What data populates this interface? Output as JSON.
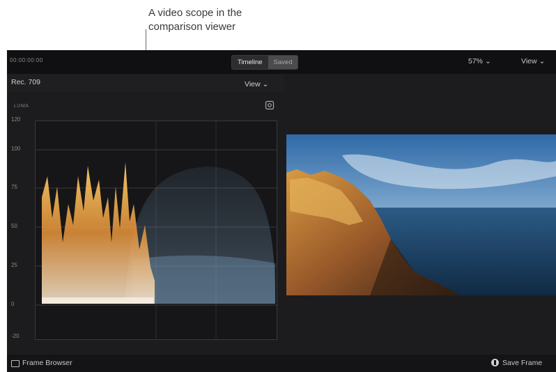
{
  "callout": {
    "line1": "A video scope in the",
    "line2": "comparison viewer"
  },
  "topbar": {
    "timecode": "00:00:00:00",
    "tabs": [
      "Timeline",
      "Saved"
    ],
    "zoom": "57%",
    "view": "View"
  },
  "scope": {
    "title": "Rec. 709",
    "view": "View",
    "label": "LUMA",
    "ticks": [
      "120",
      "100",
      "75",
      "50",
      "25",
      "0",
      "-20"
    ],
    "icon": "settings-icon"
  },
  "bottombar": {
    "frame_browser": "Frame Browser",
    "save_frame": "Save Frame"
  },
  "colors": {
    "background": "#1c1c1e",
    "waveform_warm": "#e8a03a",
    "waveform_cool": "#6d8fb0"
  }
}
